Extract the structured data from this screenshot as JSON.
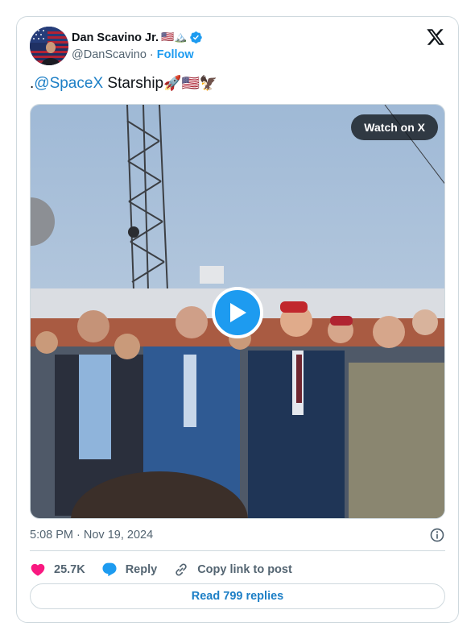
{
  "author": {
    "display_name": "Dan Scavino Jr.",
    "name_emojis": "🇺🇸🏔️",
    "handle": "@DanScavino",
    "separator": "·",
    "follow_label": "Follow",
    "verified": true
  },
  "tweet": {
    "prefix": ".",
    "mention": "@SpaceX",
    "text": " Starship",
    "emojis": "🚀🇺🇸🦅"
  },
  "media": {
    "watch_label": "Watch on X"
  },
  "meta": {
    "timestamp": "5:08 PM · Nov 19, 2024"
  },
  "actions": {
    "likes": "25.7K",
    "reply_label": "Reply",
    "copy_label": "Copy link to post"
  },
  "replies": {
    "label": "Read 799 replies"
  },
  "colors": {
    "accent": "#1d9bf0",
    "link": "#1d7fc6",
    "heart": "#f91880",
    "border": "#cfd9de",
    "muted": "#536471"
  }
}
